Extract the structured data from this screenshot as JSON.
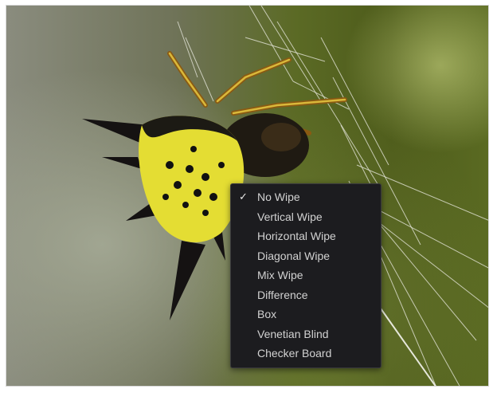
{
  "viewer": {
    "image": "spiny-orb-weaver-spider-photo"
  },
  "wipe_menu": {
    "checked_index": 0,
    "check_icon": "checkmark-icon",
    "items": [
      {
        "label": "No Wipe",
        "checked": true
      },
      {
        "label": "Vertical Wipe",
        "checked": false
      },
      {
        "label": "Horizontal Wipe",
        "checked": false
      },
      {
        "label": "Diagonal Wipe",
        "checked": false
      },
      {
        "label": "Mix Wipe",
        "checked": false
      },
      {
        "label": "Difference",
        "checked": false
      },
      {
        "label": "Box",
        "checked": false
      },
      {
        "label": "Venetian Blind",
        "checked": false
      },
      {
        "label": "Checker Board",
        "checked": false
      }
    ]
  },
  "colors": {
    "menu_background": "#1c1c1f",
    "menu_text": "#d2d2d2",
    "spider_yellow": "#e7e23a"
  }
}
